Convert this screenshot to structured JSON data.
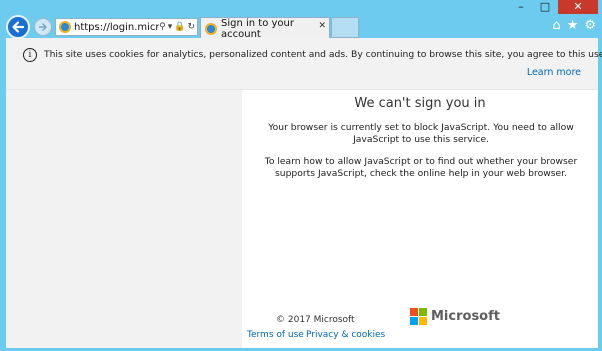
{
  "window": {
    "minimize": "–",
    "maximize": "□",
    "close": "✕"
  },
  "toolbar": {
    "address": "https://login.micr...",
    "addr_controls": [
      "search-icon",
      "chevron-down-icon",
      "lock-icon",
      "refresh-icon"
    ],
    "tools_icons": [
      "home-icon",
      "star-icon",
      "gear-icon"
    ]
  },
  "tab": {
    "title": "Sign in to your account",
    "close_label": "✕"
  },
  "cookie_banner": {
    "text": "This site uses cookies for analytics, personalized content and ads. By continuing to browse this site, you agree to this use.",
    "learn_more": "Learn more",
    "icon_glyph": "i"
  },
  "content": {
    "heading": "We can't sign you in",
    "para1": "Your browser is currently set to block JavaScript. You need to allow JavaScript to use this service.",
    "para2": "To learn how to allow JavaScript or to find out whether your browser supports JavaScript, check the online help in your web browser."
  },
  "footer": {
    "copyright": "© 2017 Microsoft",
    "brand": "Microsoft",
    "terms": "Terms of use",
    "privacy": "Privacy & cookies"
  },
  "colors": {
    "chrome": "#6ccbee",
    "link": "#0067b8",
    "ms_red": "#f25022",
    "ms_green": "#7fba00",
    "ms_blue": "#00a4ef",
    "ms_yellow": "#ffb900"
  }
}
